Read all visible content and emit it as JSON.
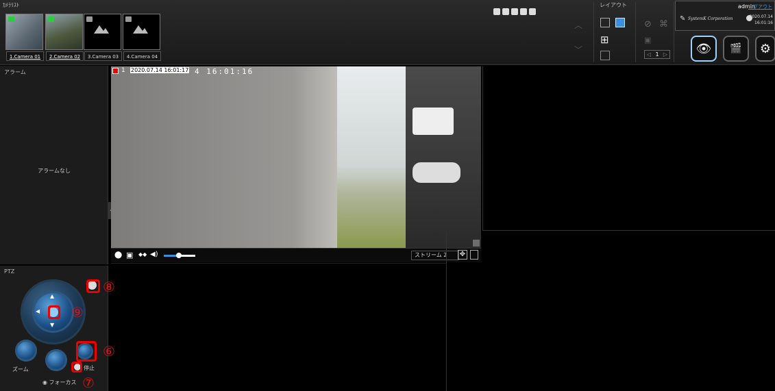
{
  "camera_list": {
    "label": "ｶﾒﾗﾘｽﾄ",
    "items": [
      {
        "name": "1.Camera 01",
        "status": "green"
      },
      {
        "name": "2.Camera 02",
        "status": "green"
      },
      {
        "name": "3.Camera 03",
        "status": "grey"
      },
      {
        "name": "4.Camera 04",
        "status": "grey"
      }
    ]
  },
  "layout": {
    "label": "レイアウト",
    "page": "1"
  },
  "user": {
    "name": "admin",
    "logout": "ログアウト",
    "company": "SystemK Corporation",
    "date": "2020.07.14",
    "time": "16:01:16"
  },
  "alarm": {
    "title": "アラーム",
    "empty": "アラームなし"
  },
  "ptz": {
    "title": "PTZ",
    "zoom": "ズーム",
    "focus": "フォーカス",
    "stop": "停止"
  },
  "video": {
    "index": "1",
    "timestamp": "2020.07.14 16:01:17",
    "overlay": "4 16:01:16"
  },
  "controls": {
    "stream": "ストリーム 2"
  },
  "annotations": [
    "⑧",
    "⑨",
    "⑥",
    "⑦"
  ],
  "colors": {
    "accent": "#4aa3ff",
    "annotation": "#e00000",
    "status_green": "#2ecc40"
  }
}
